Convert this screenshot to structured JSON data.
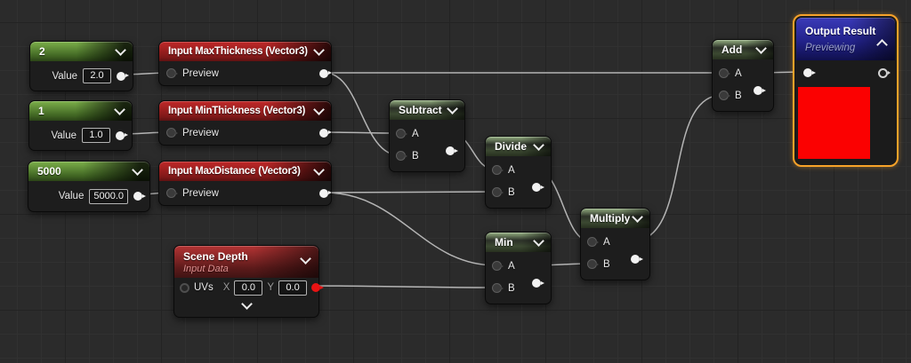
{
  "colors": {
    "selection_orange": "#f7a229",
    "wire_gray": "#b5b5b5",
    "preview_red": "#fb0101",
    "constant_header_green": "#7cb04a",
    "function_input_header_red": "#c02828",
    "math_header_sage": "#96b183",
    "output_header_blue": "#3a3ab8"
  },
  "nodes": {
    "const2": {
      "title": "2",
      "value_label": "Value",
      "value": "2.0"
    },
    "const1": {
      "title": "1",
      "value_label": "Value",
      "value": "1.0"
    },
    "const5000": {
      "title": "5000",
      "value_label": "Value",
      "value": "5000.0"
    },
    "input_max_thickness": {
      "title": "Input MaxThickness (Vector3)",
      "preview_label": "Preview"
    },
    "input_min_thickness": {
      "title": "Input MinThickness (Vector3)",
      "preview_label": "Preview"
    },
    "input_max_distance": {
      "title": "Input MaxDistance (Vector3)",
      "preview_label": "Preview"
    },
    "scene_depth": {
      "title": "Scene Depth",
      "subtitle": "Input Data",
      "uvs_label": "UVs",
      "x_label": "X",
      "x_value": "0.0",
      "y_label": "Y",
      "y_value": "0.0"
    },
    "subtract": {
      "title": "Subtract",
      "pin_a": "A",
      "pin_b": "B"
    },
    "divide": {
      "title": "Divide",
      "pin_a": "A",
      "pin_b": "B"
    },
    "min": {
      "title": "Min",
      "pin_a": "A",
      "pin_b": "B"
    },
    "multiply": {
      "title": "Multiply",
      "pin_a": "A",
      "pin_b": "B"
    },
    "add": {
      "title": "Add",
      "pin_a": "A",
      "pin_b": "B"
    },
    "output_result": {
      "title": "Output Result",
      "status": "Previewing"
    }
  },
  "connections": [
    {
      "from": "2",
      "to": "Input MaxThickness (Vector3).Preview"
    },
    {
      "from": "1",
      "to": "Input MinThickness (Vector3).Preview"
    },
    {
      "from": "5000",
      "to": "Input MaxDistance (Vector3).Preview"
    },
    {
      "from": "Input MaxThickness (Vector3)",
      "to": "Add.A"
    },
    {
      "from": "Input MaxThickness (Vector3)",
      "to": "Subtract.B"
    },
    {
      "from": "Input MinThickness (Vector3)",
      "to": "Subtract.A"
    },
    {
      "from": "Input MaxDistance (Vector3)",
      "to": "Divide.B"
    },
    {
      "from": "Input MaxDistance (Vector3)",
      "to": "Min.A"
    },
    {
      "from": "Scene Depth",
      "to": "Min.B"
    },
    {
      "from": "Subtract",
      "to": "Divide.A"
    },
    {
      "from": "Divide",
      "to": "Multiply.A"
    },
    {
      "from": "Min",
      "to": "Multiply.B"
    },
    {
      "from": "Multiply",
      "to": "Add.B"
    },
    {
      "from": "Add",
      "to": "Output Result"
    }
  ]
}
